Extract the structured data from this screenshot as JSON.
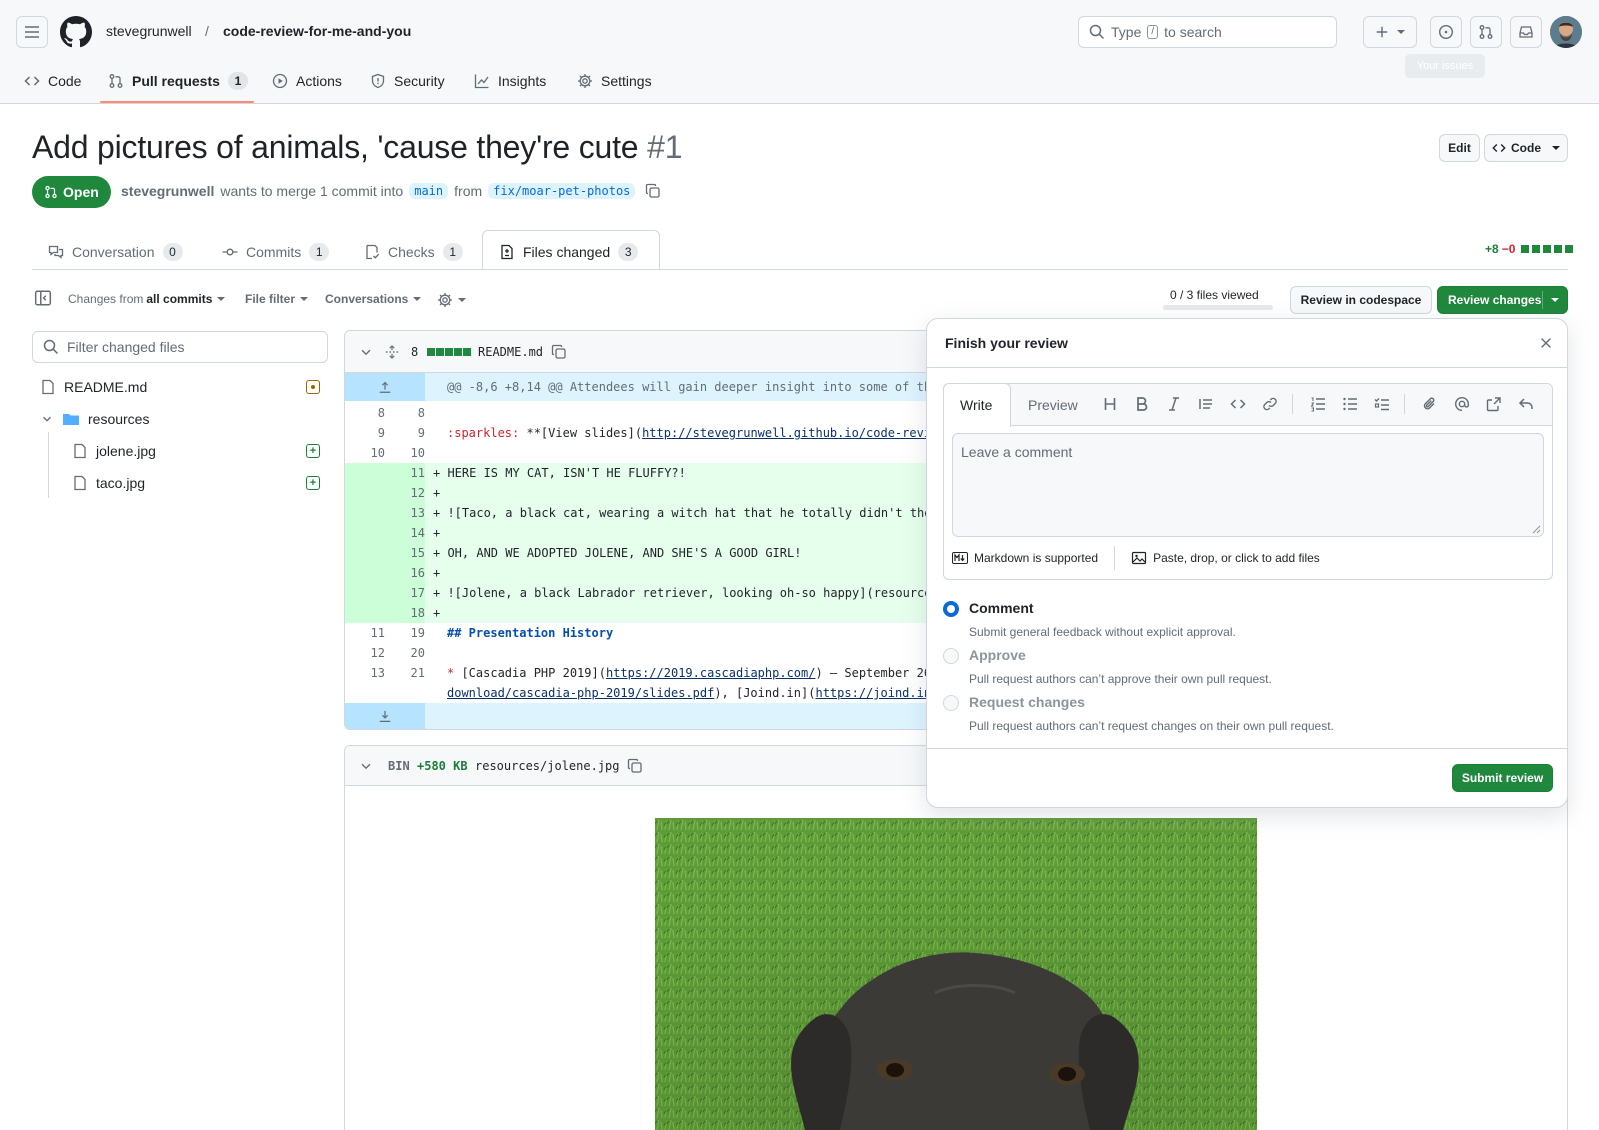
{
  "header": {
    "owner": "stevegrunwell",
    "separator": "/",
    "repo": "code-review-for-me-and-you",
    "search_prefix": "Type",
    "search_key": "/",
    "search_suffix": "to search",
    "tooltip": "Your issues"
  },
  "repo_nav": [
    {
      "label": "Code",
      "icon": "code-icon"
    },
    {
      "label": "Pull requests",
      "icon": "git-pull-request-icon",
      "count": "1"
    },
    {
      "label": "Actions",
      "icon": "play-icon"
    },
    {
      "label": "Security",
      "icon": "shield-icon"
    },
    {
      "label": "Insights",
      "icon": "graph-icon"
    },
    {
      "label": "Settings",
      "icon": "gear-icon"
    }
  ],
  "pr": {
    "title": "Add pictures of animals, 'cause they're cute",
    "number": "#1",
    "edit_label": "Edit",
    "code_label": "Code",
    "state": "Open",
    "author": "stevegrunwell",
    "merge_text": "wants to merge 1 commit into",
    "base_branch": "main",
    "from_text": "from",
    "head_branch": "fix/moar-pet-photos"
  },
  "tabs": [
    {
      "label": "Conversation",
      "count": "0",
      "icon": "comment-discussion-icon"
    },
    {
      "label": "Commits",
      "count": "1",
      "icon": "git-commit-icon"
    },
    {
      "label": "Checks",
      "count": "1",
      "icon": "checklist-icon"
    },
    {
      "label": "Files changed",
      "count": "3",
      "icon": "file-diff-icon"
    }
  ],
  "diffstat": {
    "additions": "+8",
    "deletions": "−0"
  },
  "toolbar": {
    "changes_from_prefix": "Changes from",
    "changes_from_value": "all commits",
    "file_filter": "File filter",
    "conversations": "Conversations",
    "files_viewed": "0 / 3 files viewed",
    "review_in_codespace": "Review in codespace",
    "review_changes": "Review changes"
  },
  "file_tree": {
    "filter_placeholder": "Filter changed files",
    "items": [
      {
        "name": "README.md",
        "type": "file",
        "status": "modified"
      },
      {
        "name": "resources",
        "type": "folder"
      },
      {
        "name": "jolene.jpg",
        "type": "file",
        "status": "added"
      },
      {
        "name": "taco.jpg",
        "type": "file",
        "status": "added"
      }
    ]
  },
  "diff": {
    "changes": "8",
    "filename": "README.md",
    "hunk": "@@ -8,6 +8,14 @@ Attendees will gain deeper insight into some of th",
    "lines": [
      {
        "old": "8",
        "new": "8",
        "type": "ctx",
        "text": ""
      },
      {
        "old": "9",
        "new": "9",
        "type": "ctx",
        "text": ":sparkles: **[View slides](http://stevegrunwell.github.io/code-revi"
      },
      {
        "old": "10",
        "new": "10",
        "type": "ctx",
        "text": ""
      },
      {
        "old": "",
        "new": "11",
        "type": "add",
        "text": "+ HERE IS MY CAT, ISN'T HE FLUFFY?!"
      },
      {
        "old": "",
        "new": "12",
        "type": "add",
        "text": "+"
      },
      {
        "old": "",
        "new": "13",
        "type": "add",
        "text": "+ ![Taco, a black cat, wearing a witch hat that he totally didn't the"
      },
      {
        "old": "",
        "new": "14",
        "type": "add",
        "text": "+"
      },
      {
        "old": "",
        "new": "15",
        "type": "add",
        "text": "+ OH, AND WE ADOPTED JOLENE, AND SHE'S A GOOD GIRL!"
      },
      {
        "old": "",
        "new": "16",
        "type": "add",
        "text": "+"
      },
      {
        "old": "",
        "new": "17",
        "type": "add",
        "text": "+ ![Jolene, a black Labrador retriever, looking oh-so happy](resource"
      },
      {
        "old": "",
        "new": "18",
        "type": "add",
        "text": "+"
      },
      {
        "old": "11",
        "new": "19",
        "type": "ctx",
        "text": "## Presentation History"
      },
      {
        "old": "12",
        "new": "20",
        "type": "ctx",
        "text": ""
      },
      {
        "old": "13",
        "new": "21",
        "type": "ctx",
        "text": "* [Cascadia PHP 2019](https://2019.cascadiaphp.com/) — September 26"
      },
      {
        "old": "",
        "new": "",
        "type": "ctx",
        "text": "download/cascadia-php-2019/slides.pdf), [Joind.in](https://joind.in"
      }
    ],
    "link_slides": "http://stevegrunwell.github.io/code-revi",
    "link_cascadia": "https://2019.cascadiaphp.com/",
    "link_pdf": "download/cascadia-php-2019/slides.pdf",
    "link_joind": "https://joind.in"
  },
  "bin_file": {
    "label": "BIN",
    "size": "+580 KB",
    "filename": "resources/jolene.jpg"
  },
  "review": {
    "title": "Finish your review",
    "write_tab": "Write",
    "preview_tab": "Preview",
    "comment_placeholder": "Leave a comment",
    "markdown_note": "Markdown is supported",
    "attach_note": "Paste, drop, or click to add files",
    "options": [
      {
        "title": "Comment",
        "desc": "Submit general feedback without explicit approval.",
        "selected": true
      },
      {
        "title": "Approve",
        "desc": "Pull request authors can’t approve their own pull request.",
        "selected": false
      },
      {
        "title": "Request changes",
        "desc": "Pull request authors can’t request changes on their own pull request.",
        "selected": false
      }
    ],
    "submit": "Submit review"
  },
  "colors": {
    "accent_green": "#1f883d",
    "link_blue": "#0969da",
    "nav_underline": "#fd8c73",
    "add_bg": "#e6ffec"
  }
}
